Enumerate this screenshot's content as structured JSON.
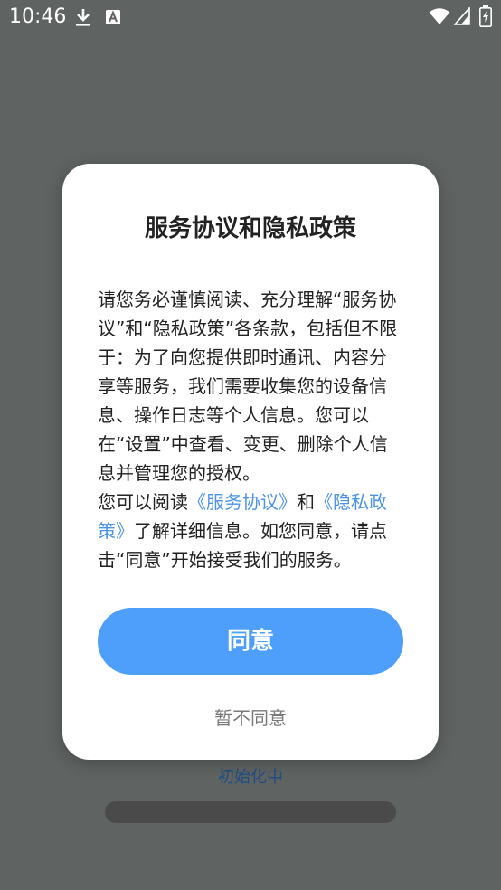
{
  "status_bar": {
    "time": "10:46",
    "icons": [
      "download-icon",
      "a-icon",
      "wifi-icon",
      "signal-icon",
      "battery-icon"
    ]
  },
  "background": {
    "loading_text": "初始化中",
    "loading_text_color": "#1f4e86"
  },
  "dialog": {
    "title": "服务协议和隐私政策",
    "body": {
      "paragraph1": "请您务必谨慎阅读、充分理解“服务协议”和“隐私政策”各条款，包括但不限于：为了向您提供即时通讯、内容分享等服务，我们需要收集您的设备信息、操作日志等个人信息。您可以在“设置”中查看、变更、删除个人信息并管理您的授权。",
      "p2_prefix": "您可以阅读",
      "service_link": "《服务协议》",
      "p2_and": "和",
      "privacy_link": "《隐私政策》",
      "p2_suffix": "了解详细信息。如您同意，请点击“同意”开始接受我们的服务。"
    },
    "agree_label": "同意",
    "disagree_label": "暂不同意"
  },
  "colors": {
    "accent": "#4d9ffb",
    "link": "#4a93e8",
    "overlay": "#5f6362"
  }
}
